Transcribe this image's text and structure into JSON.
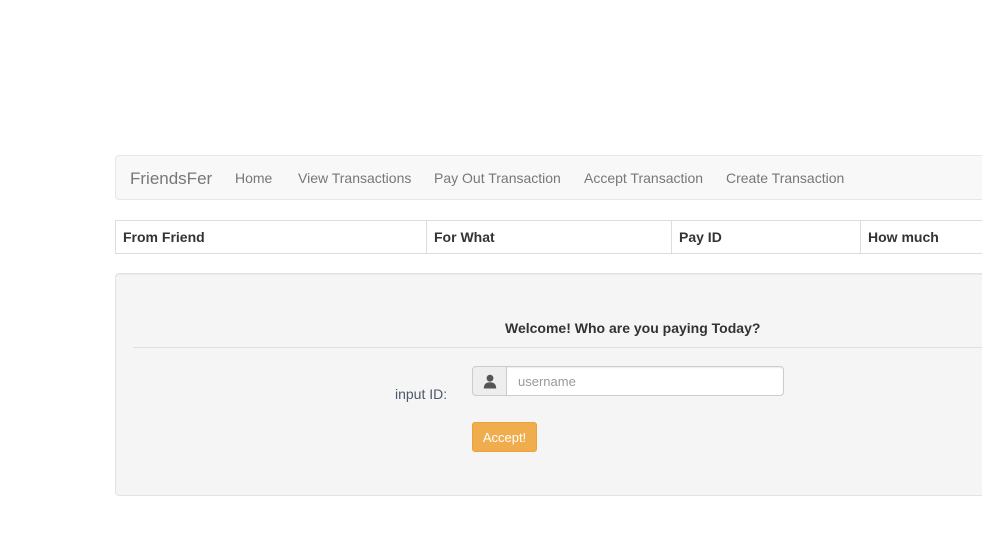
{
  "navbar": {
    "brand": "FriendsFer",
    "links": [
      "Home",
      "View Transactions",
      "Pay Out Transaction",
      "Accept Transaction",
      "Create Transaction"
    ]
  },
  "table": {
    "headers": [
      "From Friend",
      "For What",
      "Pay ID",
      "How much"
    ]
  },
  "panel": {
    "welcome": "Welcome! Who are you paying Today?",
    "input_label": "input ID:",
    "input_placeholder": "username",
    "input_value": "",
    "accept_label": "Accept!",
    "user_icon": "user-icon"
  },
  "colors": {
    "accent_button": "#f0ad4e",
    "navbar_bg": "#f8f8f8",
    "panel_bg": "#f5f5f5"
  }
}
